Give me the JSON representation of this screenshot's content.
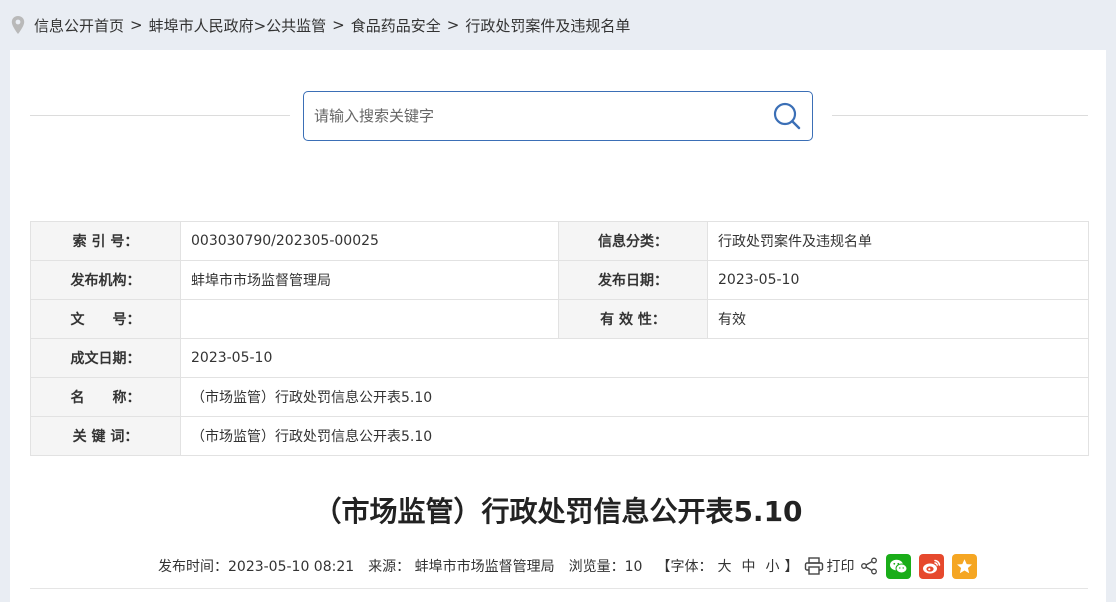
{
  "breadcrumb": {
    "items": [
      "信息公开首页",
      "蚌埠市人民政府>公共监管",
      "食品药品安全",
      "行政处罚案件及违规名单"
    ],
    "separator": ">"
  },
  "search": {
    "placeholder": "请输入搜索关键字",
    "icon": "search-icon"
  },
  "meta": {
    "index_label": "索 引 号：",
    "index_value": "003030790/202305-00025",
    "category_label": "信息分类：",
    "category_value": "行政处罚案件及违规名单",
    "org_label": "发布机构：",
    "org_value": "蚌埠市市场监督管理局",
    "pubdate_label": "发布日期：",
    "pubdate_value": "2023-05-10",
    "docno_label": "文　　号：",
    "docno_value": "",
    "validity_label": "有 效 性：",
    "validity_value": "有效",
    "written_label": "成文日期：",
    "written_value": "2023-05-10",
    "name_label": "名　　称：",
    "name_value": "（市场监管）行政处罚信息公开表5.10",
    "keyword_label": "关 键 词：",
    "keyword_value": "（市场监管）行政处罚信息公开表5.10"
  },
  "article": {
    "title": "（市场监管）行政处罚信息公开表5.10",
    "publish_time": "发布时间：2023-05-10 08:21",
    "source": "来源： 蚌埠市市场监督管理局",
    "views": "浏览量：10",
    "font_open": "【字体：",
    "font_large": "大",
    "font_medium": "中",
    "font_small": "小",
    "font_close": "】",
    "print": "打印"
  },
  "colors": {
    "accent": "#3b6fb6",
    "wechat": "#1aad19",
    "weibo": "#e6492d",
    "favorite": "#f5a623"
  }
}
